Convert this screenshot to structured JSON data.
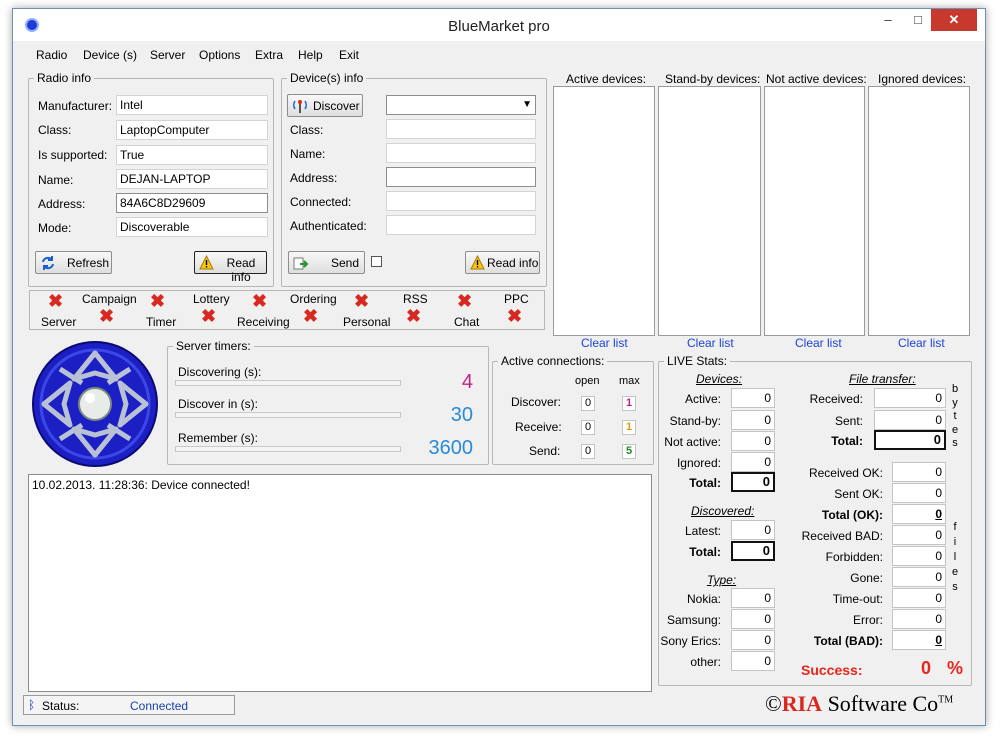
{
  "window": {
    "title": "BlueMarket pro",
    "min_glyph": "‒",
    "max_glyph": "□",
    "close_glyph": "✕"
  },
  "menu": [
    "Radio",
    "Device (s)",
    "Server",
    "Options",
    "Extra",
    "Help",
    "Exit"
  ],
  "radio_info": {
    "legend": "Radio info",
    "fields": [
      {
        "label": "Manufacturer:",
        "value": "Intel"
      },
      {
        "label": "Class:",
        "value": "LaptopComputer"
      },
      {
        "label": "Is supported:",
        "value": "True"
      },
      {
        "label": "Name:",
        "value": "DEJAN-LAPTOP"
      },
      {
        "label": "Address:",
        "value": "84A6C8D29609"
      },
      {
        "label": "Mode:",
        "value": "Discoverable"
      }
    ],
    "refresh_label": "Refresh",
    "read_info_label": "Read info"
  },
  "device_info": {
    "legend": "Device(s) info",
    "discover_label": "Discover",
    "device_select": "",
    "fields": [
      {
        "label": "Class:",
        "value": ""
      },
      {
        "label": "Name:",
        "value": ""
      },
      {
        "label": "Address:",
        "value": ""
      },
      {
        "label": "Connected:",
        "value": ""
      },
      {
        "label": "Authenticated:",
        "value": ""
      }
    ],
    "send_label": "Send",
    "read_info_label": "Read info"
  },
  "modules": {
    "top": [
      "Campaign",
      "Lottery",
      "Ordering",
      "RSS",
      "PPC"
    ],
    "bottom": [
      "Server",
      "Timer",
      "Receiving",
      "Personal",
      "Chat"
    ]
  },
  "device_lists": {
    "headers": [
      "Active devices:",
      "Stand-by devices:",
      "Not active devices:",
      "Ignored devices:"
    ],
    "clear_label": "Clear list"
  },
  "server_timers": {
    "legend": "Server timers:",
    "items": [
      {
        "label": "Discovering (s):",
        "value": "4",
        "color": "#c3208a"
      },
      {
        "label": "Discover in (s):",
        "value": "30",
        "color": "#2a8ad8"
      },
      {
        "label": "Remember (s):",
        "value": "3600",
        "color": "#2a8ad8"
      }
    ]
  },
  "connections": {
    "legend": "Active connections:",
    "col_open": "open",
    "col_max": "max",
    "rows": [
      {
        "label": "Discover:",
        "open": "0",
        "max": "1",
        "max_color": "#c3208a"
      },
      {
        "label": "Receive:",
        "open": "0",
        "max": "1",
        "max_color": "#e09a10"
      },
      {
        "label": "Send:",
        "open": "0",
        "max": "5",
        "max_color": "#1f8a1f"
      }
    ]
  },
  "live_stats": {
    "legend": "LIVE Stats:",
    "devices_title": "Devices:",
    "devices": [
      {
        "label": "Active:",
        "value": "0"
      },
      {
        "label": "Stand-by:",
        "value": "0"
      },
      {
        "label": "Not active:",
        "value": "0"
      },
      {
        "label": "Ignored:",
        "value": "0"
      }
    ],
    "devices_total": {
      "label": "Total:",
      "value": "0"
    },
    "discovered_title": "Discovered:",
    "latest": {
      "label": "Latest:",
      "value": "0"
    },
    "discovered_total": {
      "label": "Total:",
      "value": "0"
    },
    "type_title": "Type:",
    "types": [
      {
        "label": "Nokia:",
        "value": "0"
      },
      {
        "label": "Samsung:",
        "value": "0"
      },
      {
        "label": "Sony Erics:",
        "value": "0"
      },
      {
        "label": "other:",
        "value": "0"
      }
    ],
    "file_transfer_title": "File transfer:",
    "bytes": [
      {
        "label": "Received:",
        "value": "0"
      },
      {
        "label": "Sent:",
        "value": "0"
      }
    ],
    "bytes_total": {
      "label": "Total:",
      "value": "0"
    },
    "bytes_vertical": [
      "b",
      "y",
      "t",
      "e",
      "s"
    ],
    "files": [
      {
        "label": "Received OK:",
        "value": "0"
      },
      {
        "label": "Sent OK:",
        "value": "0"
      },
      {
        "label": "Total (OK):",
        "value": "0",
        "bold": true
      },
      {
        "label": "Received BAD:",
        "value": "0"
      },
      {
        "label": "Forbidden:",
        "value": "0"
      },
      {
        "label": "Gone:",
        "value": "0"
      },
      {
        "label": "Time-out:",
        "value": "0"
      },
      {
        "label": "Error:",
        "value": "0"
      },
      {
        "label": "Total (BAD):",
        "value": "0",
        "bold": true
      }
    ],
    "files_vertical": [
      "f",
      "i",
      "l",
      "e",
      "s"
    ],
    "success_label": "Success:",
    "success_value": "0",
    "success_unit": "%"
  },
  "log": {
    "lines": [
      "10.02.2013. 11:28:36: Device connected!"
    ]
  },
  "status": {
    "label": "Status:",
    "value": "Connected"
  },
  "copyright": {
    "symbol": "©",
    "ria": "RIA",
    "rest": " Software Co",
    "tm": "TM"
  },
  "colors": {
    "accent_red": "#d8281f",
    "link_blue": "#1c43d8",
    "connected_blue": "#1a3fa8"
  }
}
